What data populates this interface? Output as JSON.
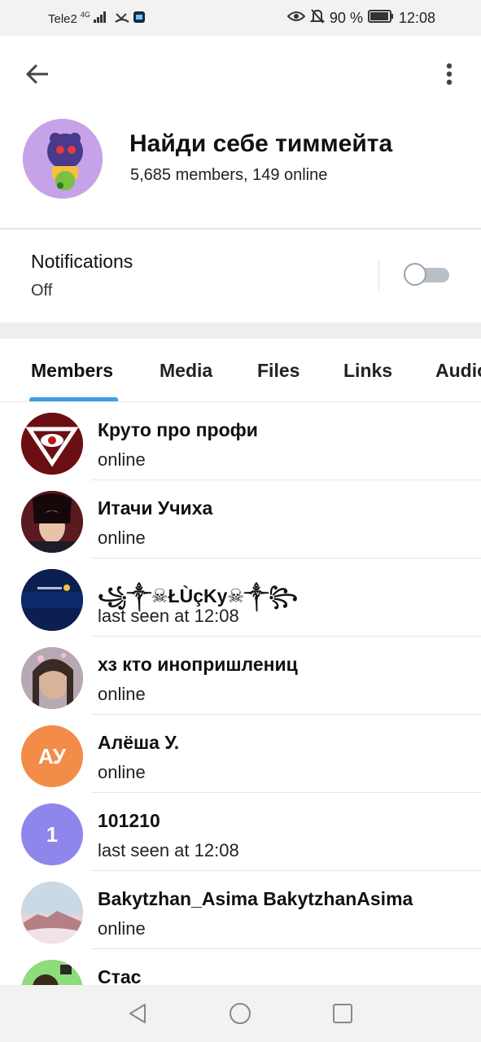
{
  "status_bar": {
    "carrier": "Tele2",
    "network": "4G",
    "battery_percent": "90 %",
    "time": "12:08"
  },
  "header": {
    "group_name": "Найди себе тиммейта",
    "group_subtitle": "5,685 members, 149 online"
  },
  "notifications": {
    "label": "Notifications",
    "value": "Off",
    "enabled": false
  },
  "tabs": [
    {
      "label": "Members",
      "active": true
    },
    {
      "label": "Media",
      "active": false
    },
    {
      "label": "Files",
      "active": false
    },
    {
      "label": "Links",
      "active": false
    },
    {
      "label": "Audio",
      "active": false
    }
  ],
  "members": [
    {
      "name": "Круто про профи",
      "status": "online",
      "avatar_color": "#6b0f12",
      "initials": ""
    },
    {
      "name": "Итачи Учиха",
      "status": "online",
      "avatar_color": "#3a1218",
      "initials": ""
    },
    {
      "name": "꧁༒☠ŁÙçKу☠༒꧂",
      "status": "last seen at 12:08",
      "avatar_color": "#0b1f52",
      "initials": ""
    },
    {
      "name": "хз кто инопришлениц",
      "status": "online",
      "avatar_color": "#8a7a86",
      "initials": ""
    },
    {
      "name": "Алёша У.",
      "status": "online",
      "avatar_color": "#f28c48",
      "initials": "АУ"
    },
    {
      "name": "101210",
      "status": "last seen at 12:08",
      "avatar_color": "#8f86ec",
      "initials": "1"
    },
    {
      "name": "Bakytzhan_Asima BakytzhanAsima",
      "status": "online",
      "avatar_color": "#d9b9bd",
      "initials": ""
    },
    {
      "name": "Стас",
      "status": "",
      "avatar_color": "#8edc7c",
      "initials": ""
    }
  ],
  "colors": {
    "accent": "#3e9ee5",
    "toggle_off": "#b9bfc7"
  }
}
